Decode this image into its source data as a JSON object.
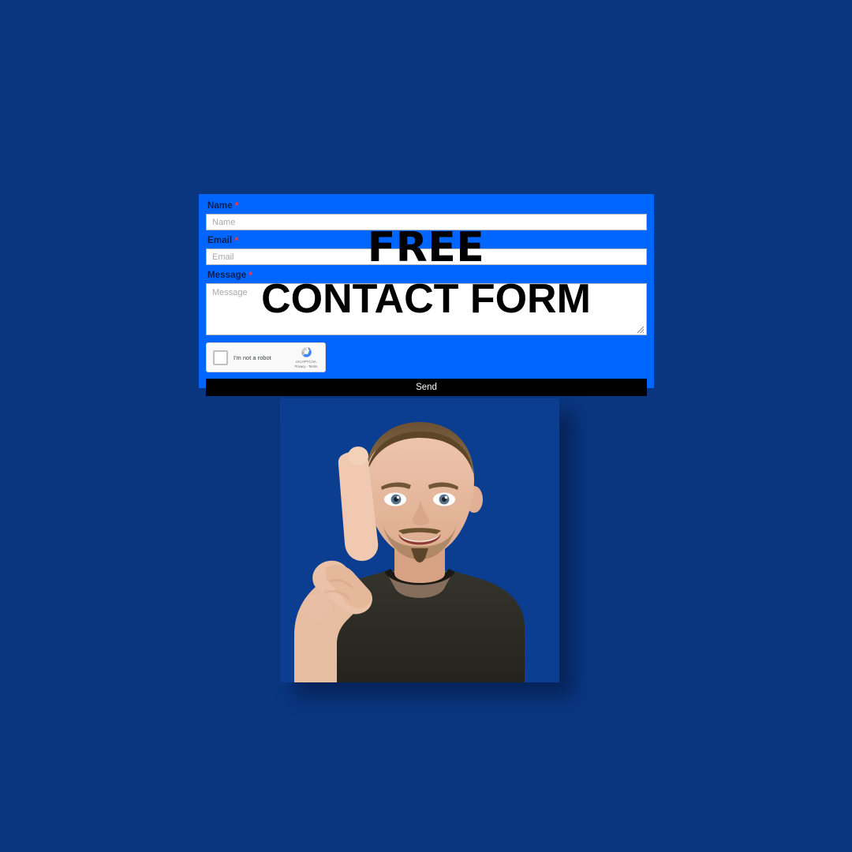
{
  "page": {
    "background_color": "#0a3680"
  },
  "overlay": {
    "line1": "FREE",
    "line2": "CONTACT FORM",
    "text_color": "#000000"
  },
  "form": {
    "background_color": "#0066ff",
    "label_color": "#0b1f4e",
    "required_marker": "*",
    "required_marker_color": "#ff3344",
    "fields": [
      {
        "name_key": "name",
        "label": "Name",
        "placeholder": "Name",
        "value": "",
        "required": true,
        "type": "text"
      },
      {
        "name_key": "email",
        "label": "Email",
        "placeholder": "Email",
        "value": "",
        "required": true,
        "type": "text"
      },
      {
        "name_key": "message",
        "label": "Message",
        "placeholder": "Message",
        "value": "",
        "required": true,
        "type": "textarea"
      }
    ],
    "recaptcha": {
      "checkbox_label": "I'm not a robot",
      "checked": false,
      "brand_name": "reCAPTCHA",
      "brand_legal": "Privacy - Terms",
      "logo_icon": "recaptcha-logo-icon"
    },
    "submit": {
      "label": "Send",
      "background_color": "#000000",
      "text_color": "#ffffff"
    },
    "resize_handle_icon": "textarea-resize-handle-icon"
  },
  "presenter": {
    "alt": "Presenter raising index finger",
    "backdrop_color": "#0b3d91"
  }
}
